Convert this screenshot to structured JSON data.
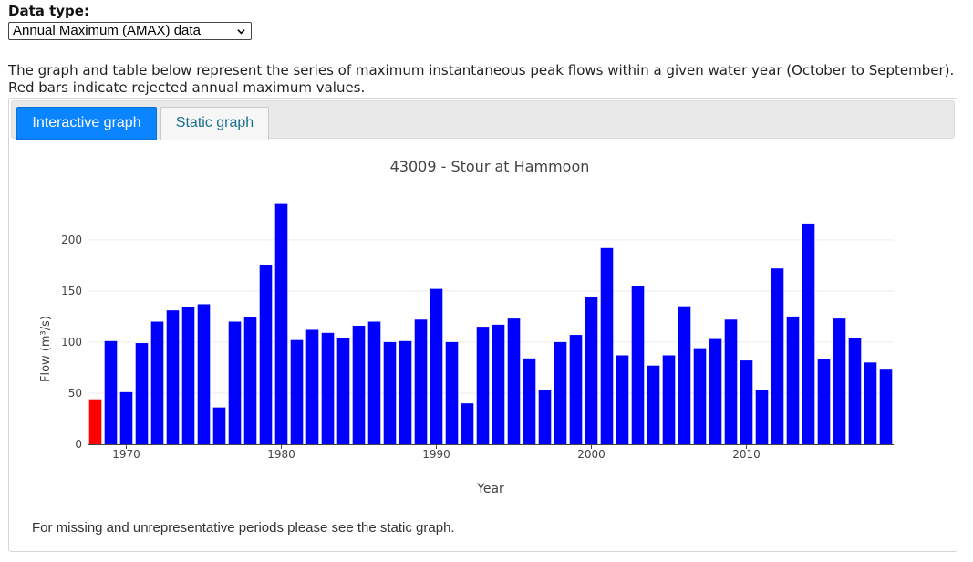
{
  "datatype": {
    "label": "Data type:",
    "selected": "Annual Maximum (AMAX) data"
  },
  "description": "The graph and table below represent the series of maximum instantaneous peak flows within a given water year (October to September). Red bars indicate rejected annual maximum values.",
  "tabs": [
    {
      "label": "Interactive graph",
      "active": true
    },
    {
      "label": "Static graph",
      "active": false
    }
  ],
  "footnote": "For missing and unrepresentative periods please see the static graph.",
  "colors": {
    "accepted": "#0000ff",
    "rejected": "#ff0000",
    "tab_active": "#0a84ff"
  },
  "chart_data": {
    "type": "bar",
    "title": "43009 - Stour at Hammoon",
    "xlabel": "Year",
    "ylabel": "Flow (m³/s)",
    "ylim": [
      0,
      240
    ],
    "xlim": [
      1967.5,
      2019.5
    ],
    "yticks": [
      0,
      50,
      100,
      150,
      200
    ],
    "xticks": [
      1970,
      1980,
      1990,
      2000,
      2010
    ],
    "grid": true,
    "x": [
      1968,
      1969,
      1970,
      1971,
      1972,
      1973,
      1974,
      1975,
      1976,
      1977,
      1978,
      1979,
      1980,
      1981,
      1982,
      1983,
      1984,
      1985,
      1986,
      1987,
      1988,
      1989,
      1990,
      1991,
      1992,
      1993,
      1994,
      1995,
      1996,
      1997,
      1998,
      1999,
      2000,
      2001,
      2002,
      2003,
      2004,
      2005,
      2006,
      2007,
      2008,
      2009,
      2010,
      2011,
      2012,
      2013,
      2014,
      2015,
      2016,
      2017,
      2018,
      2019
    ],
    "values": [
      44,
      101,
      51,
      99,
      120,
      131,
      134,
      137,
      36,
      120,
      124,
      175,
      235,
      102,
      112,
      109,
      104,
      116,
      120,
      100,
      101,
      122,
      152,
      100,
      40,
      115,
      117,
      123,
      84,
      53,
      100,
      107,
      144,
      192,
      87,
      155,
      77,
      87,
      135,
      94,
      103,
      122,
      82,
      53,
      172,
      125,
      216,
      83,
      123,
      104,
      80,
      73
    ],
    "rejected": [
      true,
      false,
      false,
      false,
      false,
      false,
      false,
      false,
      false,
      false,
      false,
      false,
      false,
      false,
      false,
      false,
      false,
      false,
      false,
      false,
      false,
      false,
      false,
      false,
      false,
      false,
      false,
      false,
      false,
      false,
      false,
      false,
      false,
      false,
      false,
      false,
      false,
      false,
      false,
      false,
      false,
      false,
      false,
      false,
      false,
      false,
      false,
      false,
      false,
      false,
      false,
      false
    ]
  }
}
